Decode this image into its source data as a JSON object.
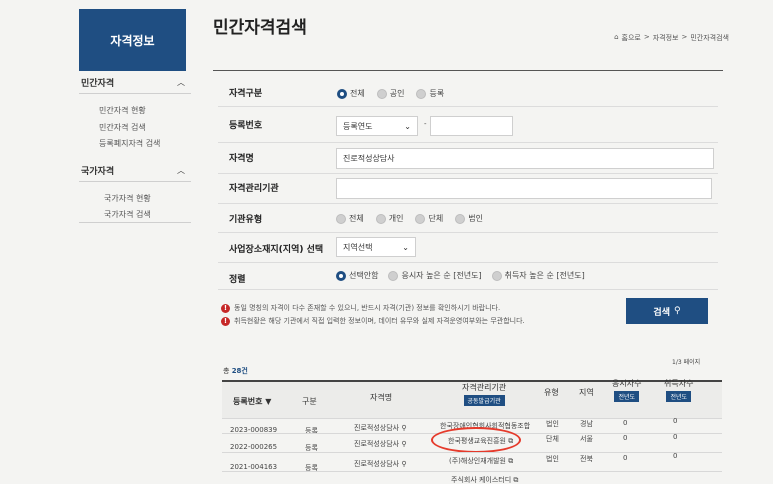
{
  "sidebar": {
    "header": "자격정보",
    "section1": {
      "title": "민간자격",
      "links": [
        "민간자격 현황",
        "민간자격 검색",
        "등록폐지자격 검색"
      ]
    },
    "section2": {
      "title": "국가자격",
      "links": [
        "국가자격 현황",
        "국가자격 검색"
      ]
    }
  },
  "page": {
    "title": "민간자격검색",
    "breadcrumb": [
      "홈으로",
      ">",
      "자격정보",
      ">",
      "민간자격검색"
    ]
  },
  "form": {
    "type_label": "자격구분",
    "type_options": [
      "전체",
      "공인",
      "등록"
    ],
    "type_selected": "전체",
    "regno_label": "등록번호",
    "regno_year_select": "등록연도",
    "regno_dash": "-",
    "regno_value": "",
    "name_label": "자격명",
    "name_value": "진로적성상담사",
    "org_label": "자격관리기관",
    "org_value": "",
    "orgtype_label": "기관유형",
    "orgtype_options": [
      "전체",
      "개인",
      "단체",
      "법인"
    ],
    "region_label": "사업장소재지(지역) 선택",
    "region_select": "지역선택",
    "sort_label": "정렬",
    "sort_options": [
      "선택안함",
      "응시자 높은 순 [전년도]",
      "취득자 높은 순 [전년도]"
    ],
    "sort_selected": "선택안함",
    "notice1": "동일 명칭의 자격이 다수 존재할 수 있으니, 반드시 자격(기관) 정보를 확인하시기 바랍니다.",
    "notice2": "취득현황은 해당 기관에서 직접 입력한 정보이며, 데이터 유무와 실제 자격운영여부와는 무관합니다.",
    "search_button": "검색"
  },
  "results": {
    "total_prefix": "총",
    "total_count": "28건",
    "page_info": "1/3 페이지",
    "columns": {
      "regno": "등록번호 ▼",
      "kind": "구분",
      "name": "자격명",
      "org": "자격관리기관",
      "org_badge": "공동발급기관",
      "orgtype": "유형",
      "region": "지역",
      "applicants": "응시자수",
      "applicants_badge": "전년도",
      "acquirers": "취득자수",
      "acquirers_badge": "전년도"
    },
    "rows": [
      {
        "regno": "2023-000839",
        "kind": "등록",
        "name": "진로적성상담사",
        "org": "한국장애인협회사회적협동조합",
        "orgtype": "법인",
        "region": "경남",
        "applicants": "0",
        "acquirers": "0"
      },
      {
        "regno": "2022-000265",
        "kind": "등록",
        "name": "진로적성상담사",
        "org": "한국평생교육진흥원",
        "orgtype": "단체",
        "region": "서울",
        "applicants": "0",
        "acquirers": "0"
      },
      {
        "regno": "2021-004163",
        "kind": "등록",
        "name": "진로적성상담사",
        "org": "(주)해상인재개발원",
        "orgtype": "법인",
        "region": "전북",
        "applicants": "0",
        "acquirers": "0"
      },
      {
        "regno": "",
        "kind": "",
        "name": "",
        "org": "주식회사 케이스터디",
        "orgtype": "",
        "region": "",
        "applicants": "",
        "acquirers": ""
      }
    ]
  },
  "colors": {
    "primary": "#1f4e82",
    "highlight": "#e53a2b",
    "warning": "#c62828"
  }
}
